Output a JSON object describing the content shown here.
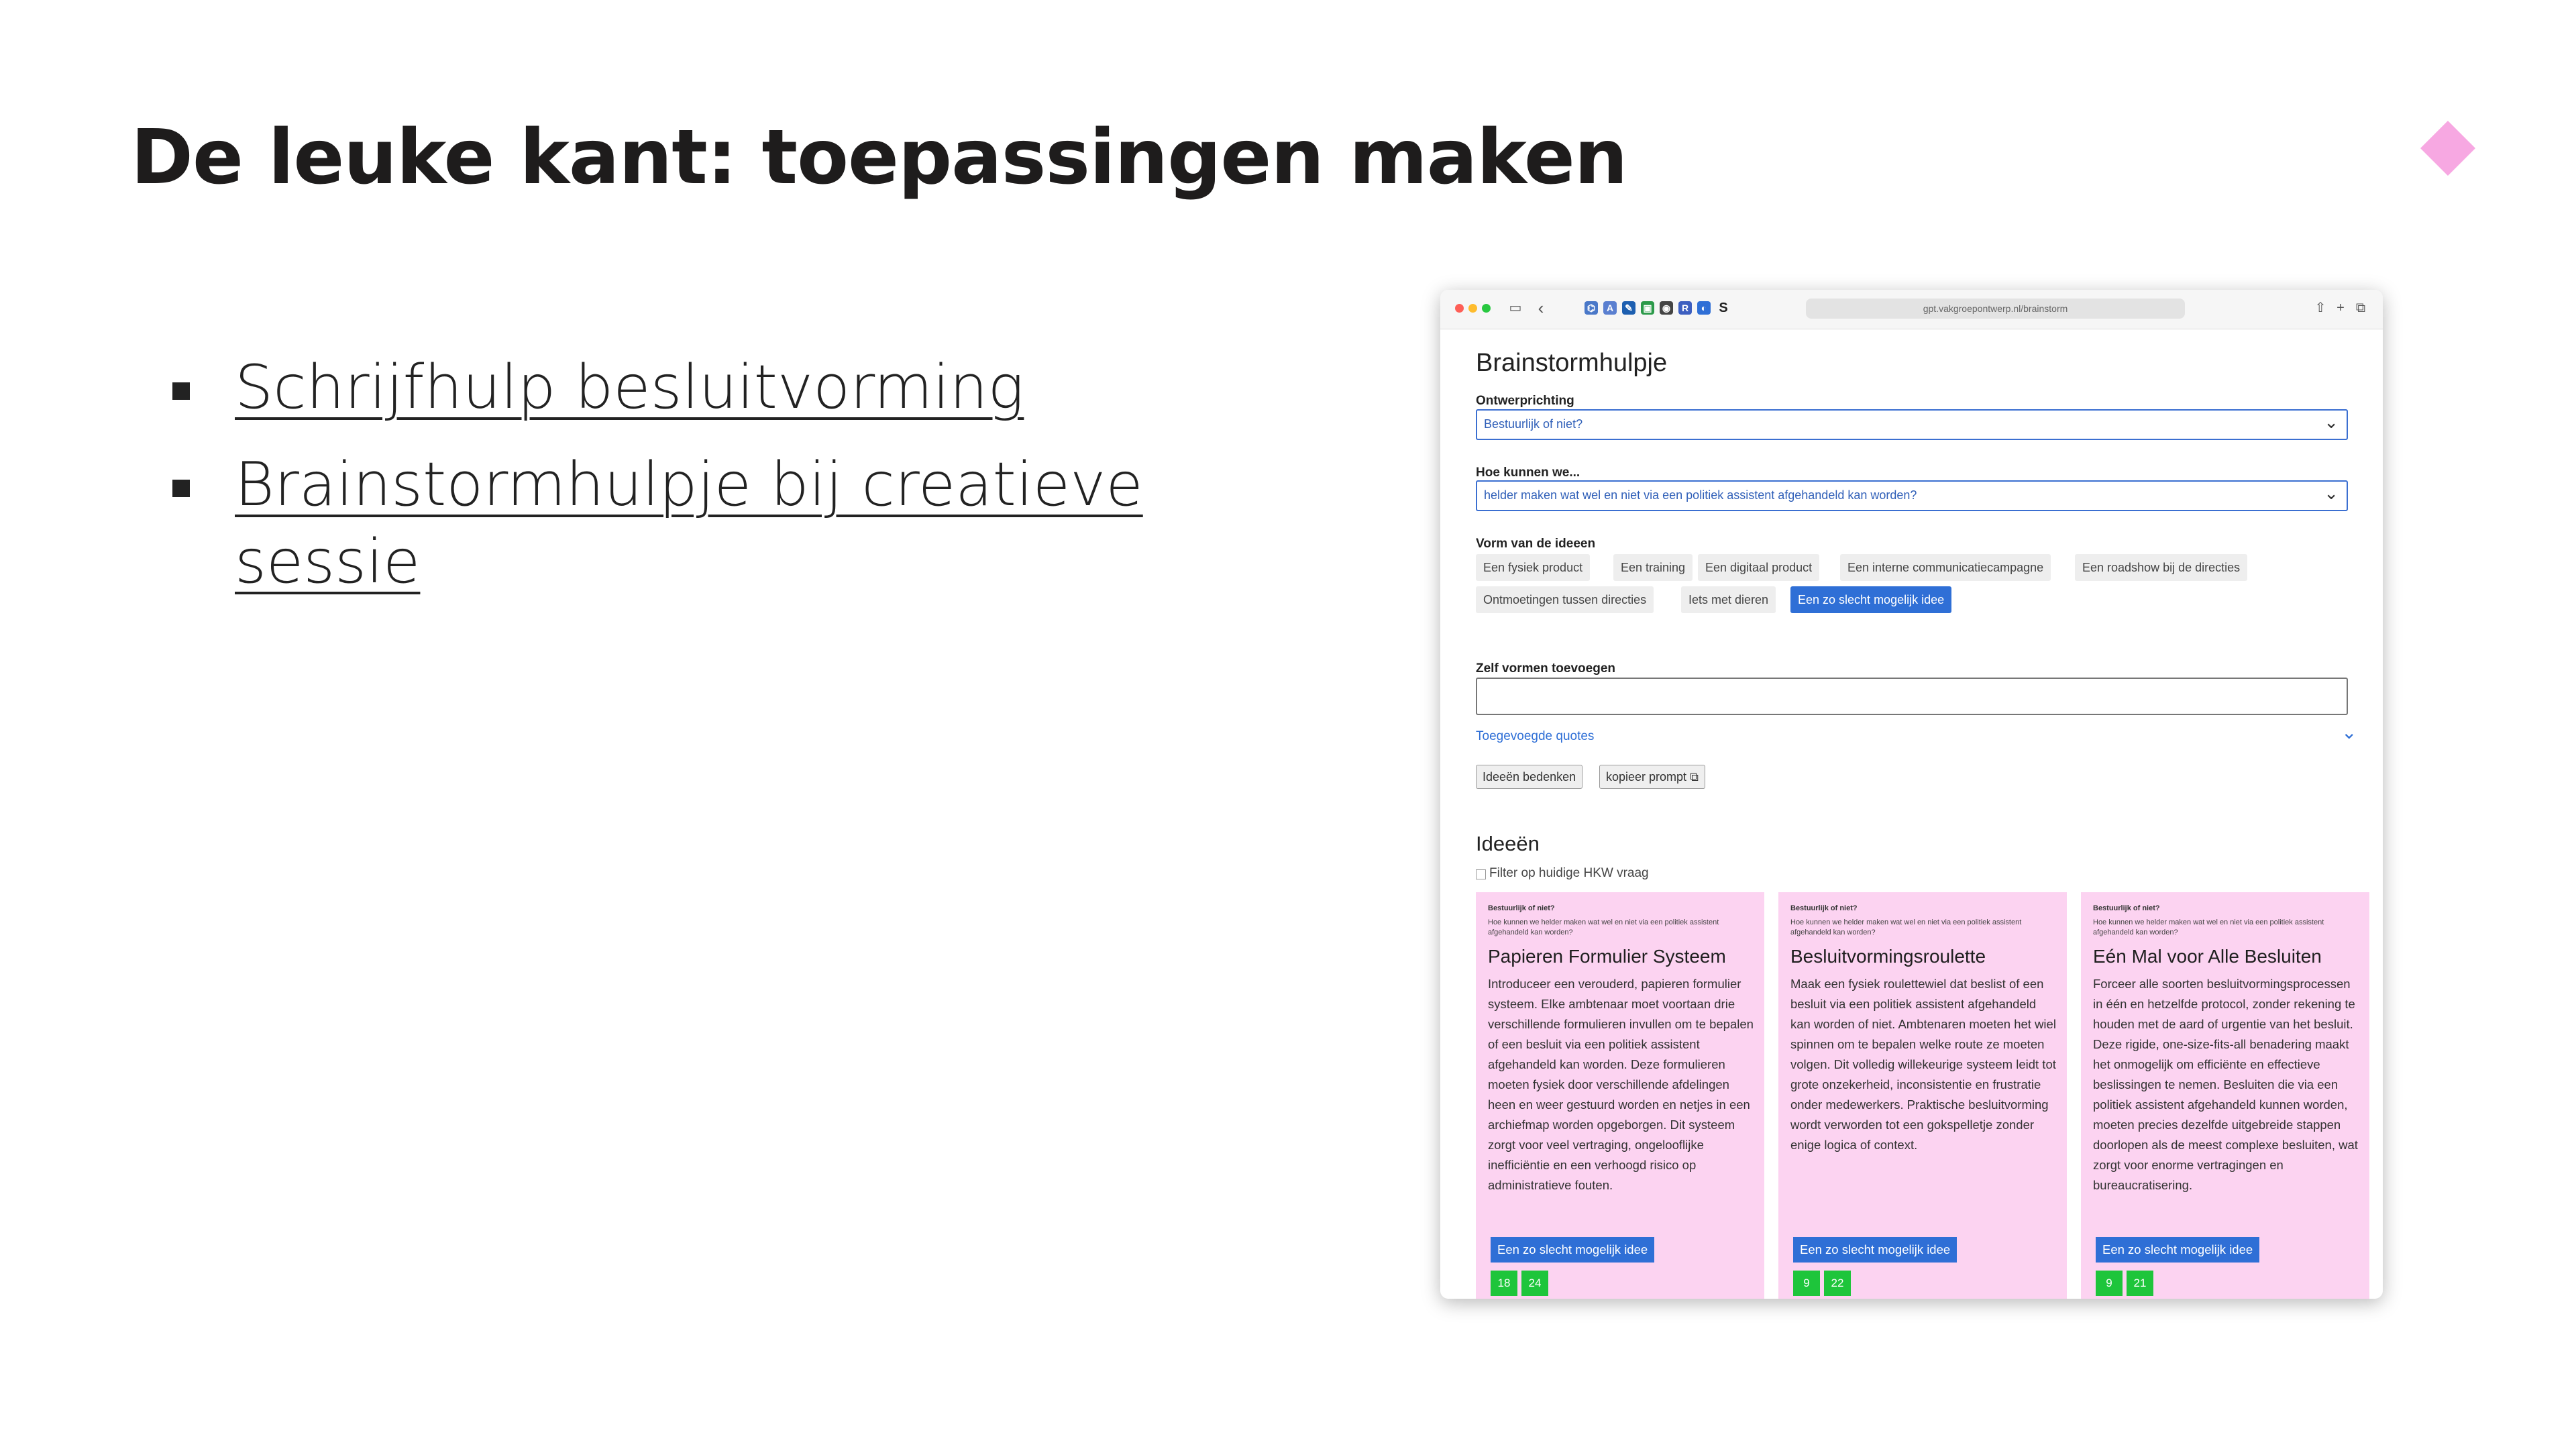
{
  "slide": {
    "title": "De leuke kant: toepassingen maken",
    "bullets": [
      "Schrijfhulp besluitvorming",
      "Brainstormhulpje bij creatieve sessie"
    ],
    "accent_color": "#f7a8e2"
  },
  "browser": {
    "url": "gpt.vakgroepontwerp.nl/brainstorm",
    "toolbar_icons": [
      "sidebar-icon",
      "back-icon",
      "share-icon",
      "new-tab-icon",
      "tabs-icon"
    ]
  },
  "app": {
    "title": "Brainstormhulpje",
    "direction_label": "Ontwerprichting",
    "direction_value": "Bestuurlijk of niet?",
    "hkw_label": "Hoe kunnen we...",
    "hkw_value": "helder maken wat wel en niet via een politiek assistent afgehandeld kan worden?",
    "forms_label": "Vorm van de ideeen",
    "forms": [
      {
        "label": "Een fysiek product",
        "selected": false
      },
      {
        "label": "Een training",
        "selected": false
      },
      {
        "label": "Een digitaal product",
        "selected": false
      },
      {
        "label": "Een interne communicatiecampagne",
        "selected": false
      },
      {
        "label": "Een roadshow bij de directies",
        "selected": false
      },
      {
        "label": "Ontmoetingen tussen directies",
        "selected": false
      },
      {
        "label": "Iets met dieren",
        "selected": false
      },
      {
        "label": "Een zo slecht mogelijk idee",
        "selected": true
      }
    ],
    "custom_forms_label": "Zelf vormen toevoegen",
    "custom_forms_value": "",
    "quotes_link": "Toegevoegde quotes",
    "ideas_button": "Ideeën bedenken",
    "copy_button": "kopieer prompt",
    "ideas_title": "Ideeën",
    "filter_label": "Filter op huidige HKW vraag",
    "filter_checked": false
  },
  "cards": [
    {
      "direction": "Bestuurlijk of niet?",
      "question": "Hoe kunnen we helder maken wat wel en niet via een politiek assistent afgehandeld kan worden?",
      "title": "Papieren Formulier Systeem",
      "body": "Introduceer een verouderd, papieren formulier systeem. Elke ambtenaar moet voortaan drie verschillende formulieren invullen om te bepalen of een besluit via een politiek assistent afgehandeld kan worden. Deze formulieren moeten fysiek door verschillende afdelingen heen en weer gestuurd worden en netjes in een archiefmap worden opgeborgen. Dit systeem zorgt voor veel vertraging, ongelooflijke inefficiëntie en een verhoogd risico op administratieve fouten.",
      "tag": "Een zo slecht mogelijk idee",
      "votes": [
        18,
        24
      ]
    },
    {
      "direction": "Bestuurlijk of niet?",
      "question": "Hoe kunnen we helder maken wat wel en niet via een politiek assistent afgehandeld kan worden?",
      "title": "Besluitvormingsroulette",
      "body": "Maak een fysiek roulettewiel dat beslist of een besluit via een politiek assistent afgehandeld kan worden of niet. Ambtenaren moeten het wiel spinnen om te bepalen welke route ze moeten volgen. Dit volledig willekeurige systeem leidt tot grote onzekerheid, inconsistentie en frustratie onder medewerkers. Praktische besluitvorming wordt verworden tot een gokspelletje zonder enige logica of context.",
      "tag": "Een zo slecht mogelijk idee",
      "votes": [
        9,
        22
      ]
    },
    {
      "direction": "Bestuurlijk of niet?",
      "question": "Hoe kunnen we helder maken wat wel en niet via een politiek assistent afgehandeld kan worden?",
      "title": "Eén Mal voor Alle Besluiten",
      "body": "Forceer alle soorten besluitvormingsprocessen in één en hetzelfde protocol, zonder rekening te houden met de aard of urgentie van het besluit. Deze rigide, one-size-fits-all benadering maakt het onmogelijk om efficiënte en effectieve beslissingen te nemen. Besluiten die via een politiek assistent afgehandeld kunnen worden, moeten precies dezelfde uitgebreide stappen doorlopen als de meest complexe besluiten, wat zorgt voor enorme vertragingen en bureaucratisering.",
      "tag": "Een zo slecht mogelijk idee",
      "votes": [
        9,
        21
      ]
    }
  ]
}
